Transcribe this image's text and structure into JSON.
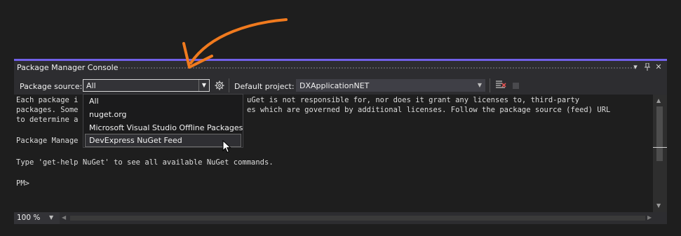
{
  "panel": {
    "title": "Package Manager Console",
    "menu_glyph": "▾",
    "pin_glyph": "⊥",
    "close_glyph": "✕"
  },
  "toolbar": {
    "package_source_label": "Package source:",
    "package_source_value": "All",
    "default_project_label": "Default project:",
    "default_project_value": "DXApplicationNET",
    "icons": [
      "settings-gear-icon",
      "clear-console-icon",
      "stop-icon"
    ]
  },
  "dropdown": {
    "options": [
      "All",
      "nuget.org",
      "Microsoft Visual Studio Offline Packages",
      "DevExpress NuGet Feed"
    ],
    "hovered_index": 3
  },
  "console": {
    "line1_a": "Each package i",
    "line1_b": "uGet is not responsible for, nor does it grant any licenses to, third-party",
    "line2_a": "packages. Some",
    "line2_b": "es which are governed by additional licenses. Follow the package source (feed) URL",
    "line3_a": "to determine a",
    "line4_a": "Package Manage",
    "line5": "Type 'get-help NuGet' to see all available NuGet commands.",
    "prompt": "PM>"
  },
  "statusbar": {
    "zoom": "100 %"
  },
  "colors": {
    "accent": "#7160e8",
    "arrow": "#f07a1e",
    "background": "#1e1e1e"
  }
}
